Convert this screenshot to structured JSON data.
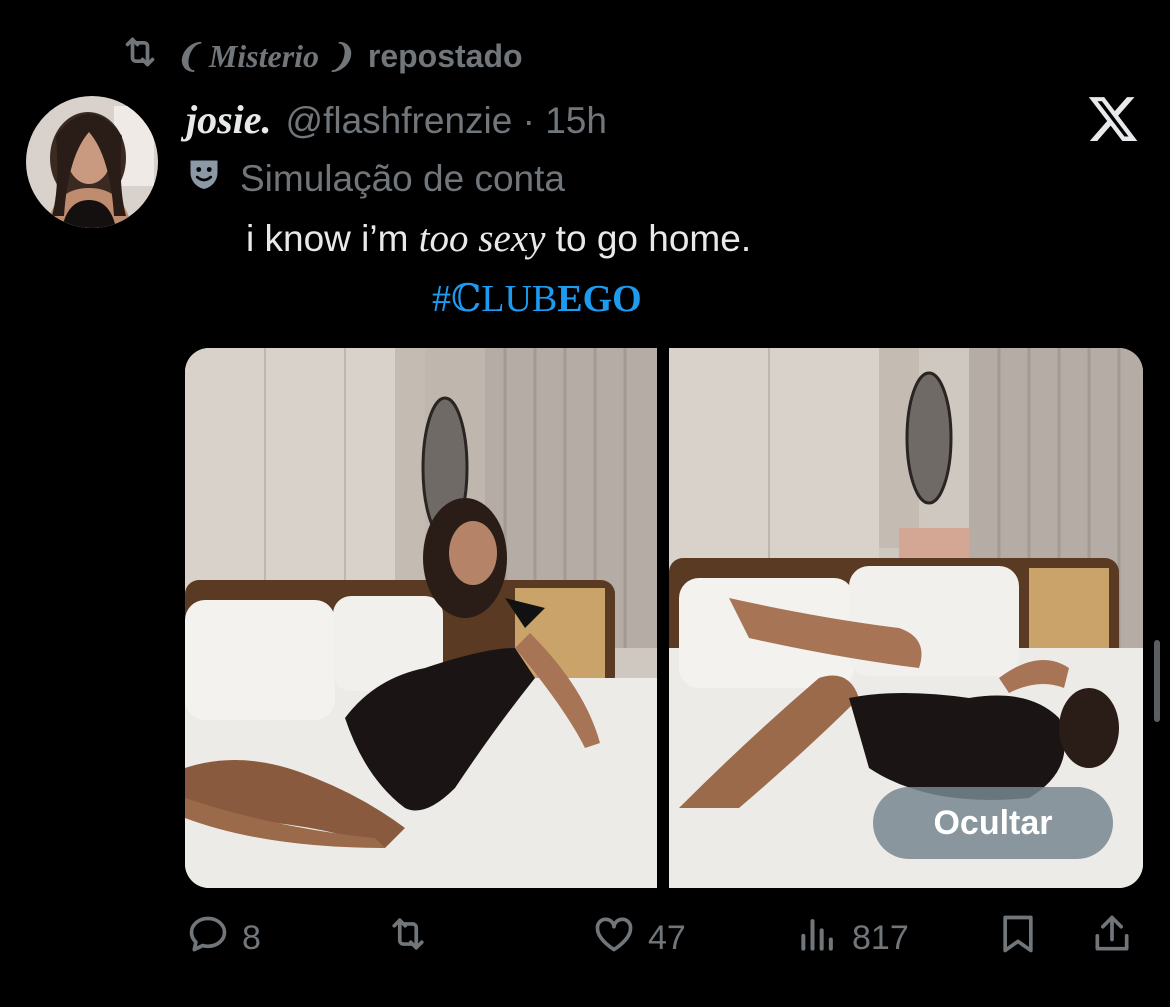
{
  "repost": {
    "name": "❨ Misterio ❩",
    "suffix": "repostado",
    "icon": "repost-icon"
  },
  "post": {
    "display_name": "josie.",
    "handle": "@flashfrenzie",
    "separator": "·",
    "time": "15h",
    "label": "Simulação de conta",
    "label_icon": "theater-masks-icon",
    "text_before": "i know i’m ",
    "text_emphasis": "too sexy",
    "text_after": " to go home.",
    "hashtag_prefix": "#ℂLUB",
    "hashtag_bold": "EGO"
  },
  "media": {
    "hide_button": "Ocultar"
  },
  "actions": {
    "replies": "8",
    "reposts": "",
    "likes": "47",
    "views": "817"
  },
  "colors": {
    "background": "#000000",
    "text_primary": "#e7e9ea",
    "text_secondary": "#71767b",
    "accent": "#1d9bf0"
  }
}
